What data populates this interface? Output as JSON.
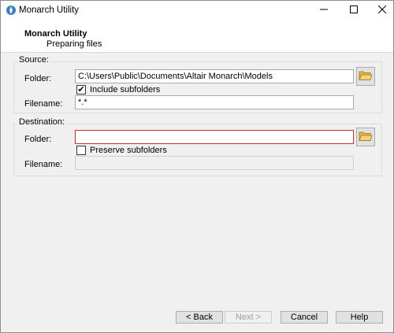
{
  "window": {
    "title": "Monarch Utility",
    "controls": {
      "minimize": "—",
      "maximize": "☐",
      "close": "✕"
    }
  },
  "header": {
    "title": "Monarch Utility",
    "subtitle": "Preparing files"
  },
  "source": {
    "group_label": "Source:",
    "folder_label": "Folder:",
    "folder_value": "C:\\Users\\Public\\Documents\\Altair Monarch\\Models",
    "include_subfolders_label": "Include subfolders",
    "include_subfolders_checked": true,
    "filename_label": "Filename:",
    "filename_value": "*.*"
  },
  "destination": {
    "group_label": "Destination:",
    "folder_label": "Folder:",
    "folder_value": "",
    "preserve_subfolders_label": "Preserve subfolders",
    "preserve_subfolders_checked": false,
    "filename_label": "Filename:",
    "filename_value": ""
  },
  "buttons": {
    "back": "< Back",
    "next": "Next >",
    "cancel": "Cancel",
    "help": "Help"
  },
  "colors": {
    "invalid_border": "#d22b2b",
    "folder_icon": "#f2c14e"
  }
}
